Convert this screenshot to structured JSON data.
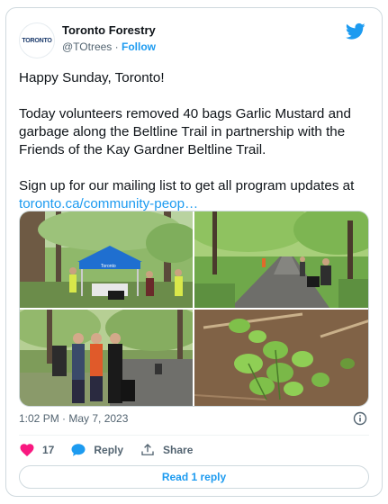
{
  "author": {
    "display_name": "Toronto Forestry",
    "handle": "@TOtrees",
    "separator": "·",
    "follow_label": "Follow",
    "avatar_text": "TORONTO"
  },
  "tweet": {
    "paragraph_1": "Happy Sunday, Toronto!",
    "paragraph_2": "Today volunteers removed 40 bags Garlic Mustard and garbage along the Beltline Trail in partnership with the Friends of the Kay Gardner Beltline Trail.",
    "paragraph_3_text": "Sign up for our mailing list to get all program updates at ",
    "paragraph_3_link": "toronto.ca/community-peop…",
    "photo_tent_sign": "Toronto"
  },
  "meta": {
    "timestamp": "1:02 PM · May 7, 2023"
  },
  "actions": {
    "like_count": "17",
    "reply_label": "Reply",
    "share_label": "Share",
    "read_replies_label": "Read 1 reply"
  },
  "colors": {
    "accent": "#1d9bf0",
    "like": "#f91880",
    "text": "#0f1419",
    "muted": "#536471"
  },
  "icons": [
    "twitter-logo-icon",
    "info-icon",
    "heart-icon",
    "reply-bubble-icon",
    "share-icon"
  ]
}
